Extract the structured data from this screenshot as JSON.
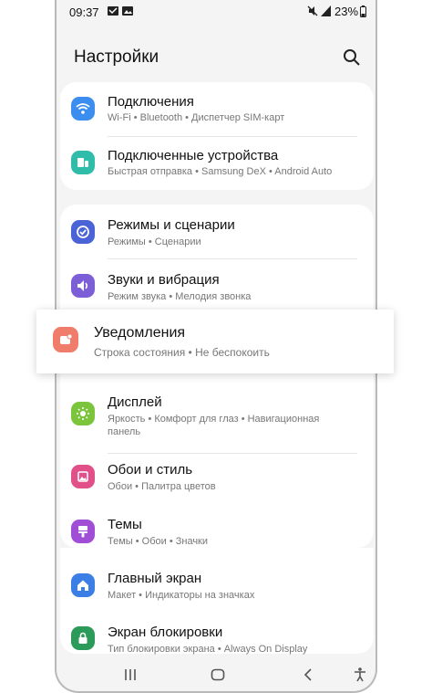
{
  "status": {
    "time": "09:37",
    "battery": "23%",
    "icons": [
      "message-icon",
      "image-icon",
      "mute-icon",
      "signal-icon",
      "battery-icon"
    ]
  },
  "header": {
    "title": "Настройки",
    "search_icon": "search-icon"
  },
  "items": [
    {
      "label": "Подключения",
      "sub": "Wi-Fi • Bluetooth • Диспетчер SIM-карт",
      "icon": "wifi-icon",
      "color": "#3b8ef0"
    },
    {
      "label": "Подключенные устройства",
      "sub": "Быстрая отправка • Samsung DeX • Android Auto",
      "icon": "devices-icon",
      "color": "#2fbdaa"
    },
    {
      "label": "Режимы и сценарии",
      "sub": "Режимы • Сценарии",
      "icon": "check-icon",
      "color": "#4a63d6"
    },
    {
      "label": "Звуки и вибрация",
      "sub": "Режим звука • Мелодия звонка",
      "icon": "volume-icon",
      "color": "#7c5fd6"
    },
    {
      "label": "Уведомления",
      "sub": "Строка состояния • Не беспокоить",
      "icon": "notification-icon",
      "color": "#f07c6c"
    },
    {
      "label": "Дисплей",
      "sub": "Яркость • Комфорт для глаз • Навигационная",
      "sub2": "панель",
      "icon": "sun-icon",
      "color": "#7cc43c"
    },
    {
      "label": "Обои и стиль",
      "sub": "Обои • Палитра цветов",
      "icon": "wallpaper-icon",
      "color": "#e2508a"
    },
    {
      "label": "Темы",
      "sub": "Темы • Обои • Значки",
      "icon": "themes-icon",
      "color": "#a04ed6"
    },
    {
      "label": "Главный экран",
      "sub": "Макет • Индикаторы на значках",
      "icon": "home-icon",
      "color": "#3a7ee6"
    },
    {
      "label": "Экран блокировки",
      "sub": "Тип блокировки экрана • Always On Display",
      "icon": "lock-icon",
      "color": "#2c9b59"
    }
  ],
  "navbar": {
    "icons": [
      "recents-icon",
      "home-button-icon",
      "back-icon",
      "accessibility-icon"
    ]
  }
}
